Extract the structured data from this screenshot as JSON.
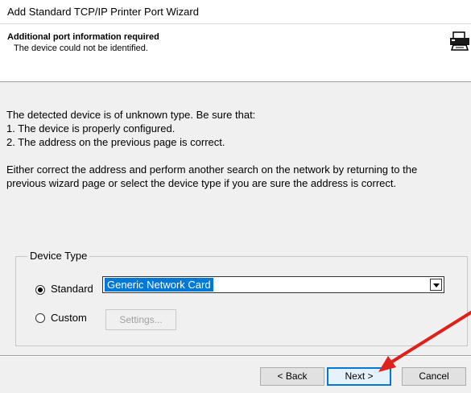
{
  "window": {
    "title": "Add Standard TCP/IP Printer Port Wizard"
  },
  "header": {
    "title": "Additional port information required",
    "subtitle": "The device could not be identified.",
    "icon": "printer-port-icon"
  },
  "body": {
    "line1": "The detected device is of unknown type.  Be sure that:",
    "line2": "1. The device is properly configured.",
    "line3": "2.  The address on the previous page is correct.",
    "line4": "Either correct the address and perform another search on the network by returning to the",
    "line5": "previous wizard page or select the device type if you are sure the address is correct."
  },
  "device_type": {
    "legend": "Device Type",
    "standard_label": "Standard",
    "standard_selected": true,
    "standard_value": "Generic Network Card",
    "custom_label": "Custom",
    "settings_label": "Settings..."
  },
  "footer": {
    "back_label": "< Back",
    "next_label": "Next >",
    "cancel_label": "Cancel"
  },
  "annotation": {
    "arrow_color": "#e0201b"
  }
}
